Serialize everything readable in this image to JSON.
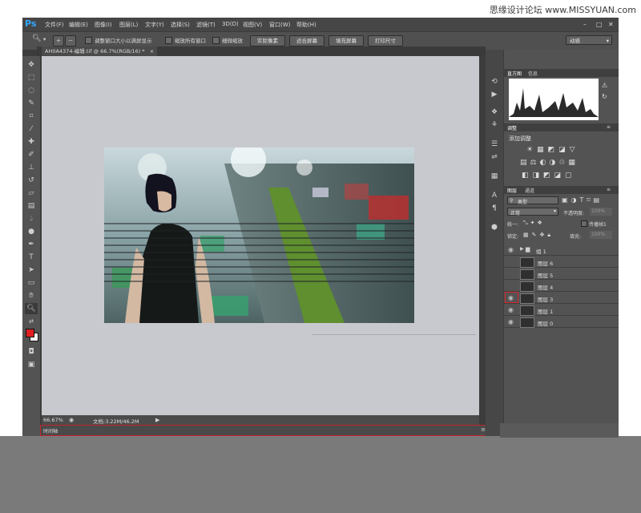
{
  "watermark": "思缘设计论坛  www.MISSYUAN.com",
  "app": {
    "logo": "Ps"
  },
  "menu": [
    "文件(F)",
    "编辑(E)",
    "图像(I)",
    "图层(L)",
    "文字(Y)",
    "选择(S)",
    "滤镜(T)",
    "3D(D)",
    "视图(V)",
    "窗口(W)",
    "帮助(H)"
  ],
  "options": {
    "check_resize": "调整窗口大小以满屏显示",
    "check_zoom_all": "缩放所有窗口",
    "check_scrubby": "细微缩放",
    "btn_actual": "实际像素",
    "btn_fit": "适合屏幕",
    "btn_fill": "填充屏幕",
    "btn_print": "打印尺寸",
    "workspace": "动感"
  },
  "document": {
    "tab": "AH0A4374-编辑.tif @ 66.7%(RGB/16) *",
    "tab_close": "×"
  },
  "status": {
    "zoom": "66.67%",
    "doc": "文档:3.22M/46.2M"
  },
  "timeline": {
    "label": "时间轴"
  },
  "panels": {
    "histogram_tabs": [
      "直方图",
      "信息"
    ],
    "adjust_tab": "调整",
    "adjust_title": "添加调整",
    "layers_tabs": [
      "图层",
      "通道"
    ],
    "kind": "类型",
    "blend": "正常",
    "opacity_label": "不透明度:",
    "opacity": "100%",
    "lock_label": "锁定:",
    "fill_label": "填充:",
    "fill": "100%",
    "unify_label": "统一:",
    "propagate": "传播帧1",
    "layers": [
      {
        "name": "组 1",
        "type": "group",
        "visible": true
      },
      {
        "name": "图层 6",
        "visible": false
      },
      {
        "name": "图层 5",
        "visible": false
      },
      {
        "name": "图层 4",
        "visible": false
      },
      {
        "name": "图层 3",
        "visible": true,
        "highlight": true
      },
      {
        "name": "图层 1",
        "visible": true
      },
      {
        "name": "图层 0",
        "visible": true
      }
    ]
  },
  "icons": {
    "eye": "eye-icon",
    "folder": "folder-icon"
  }
}
